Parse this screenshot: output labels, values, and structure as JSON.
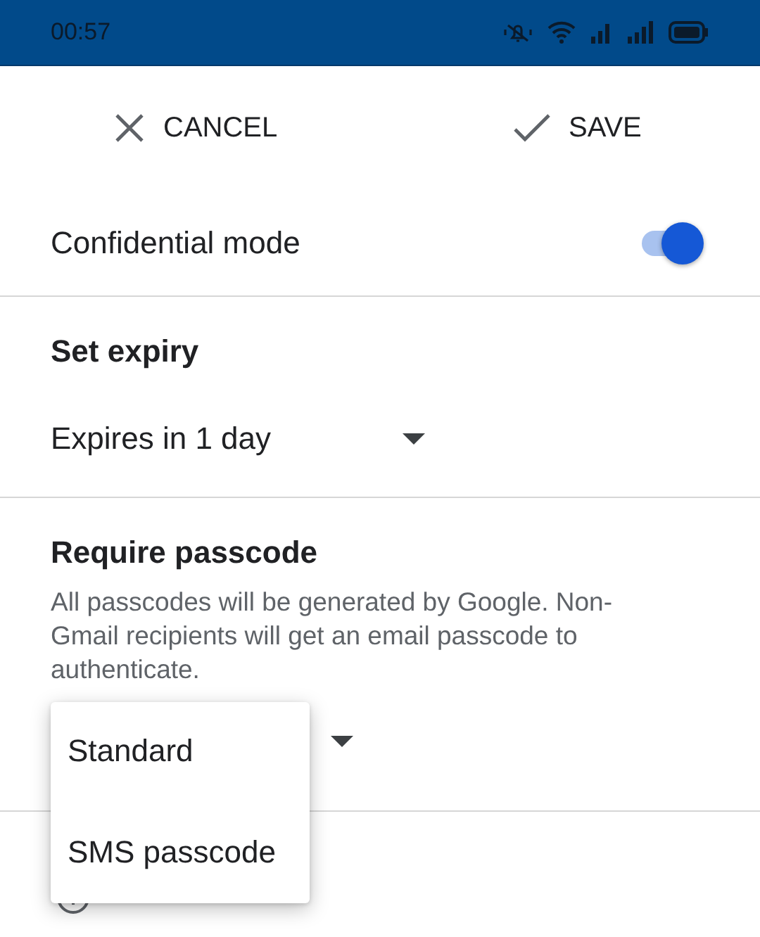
{
  "status_bar": {
    "time": "00:57"
  },
  "toolbar": {
    "cancel": "CANCEL",
    "save": "SAVE"
  },
  "confidential_mode": {
    "label": "Confidential mode",
    "on": true
  },
  "expiry": {
    "heading": "Set expiry",
    "value": "Expires in 1 day"
  },
  "passcode": {
    "heading": "Require passcode",
    "description": "All passcodes will be generated by Google. Non-Gmail recipients will get an email passcode to authenticate.",
    "menu": [
      {
        "label": "Standard"
      },
      {
        "label": "SMS passcode"
      }
    ]
  }
}
